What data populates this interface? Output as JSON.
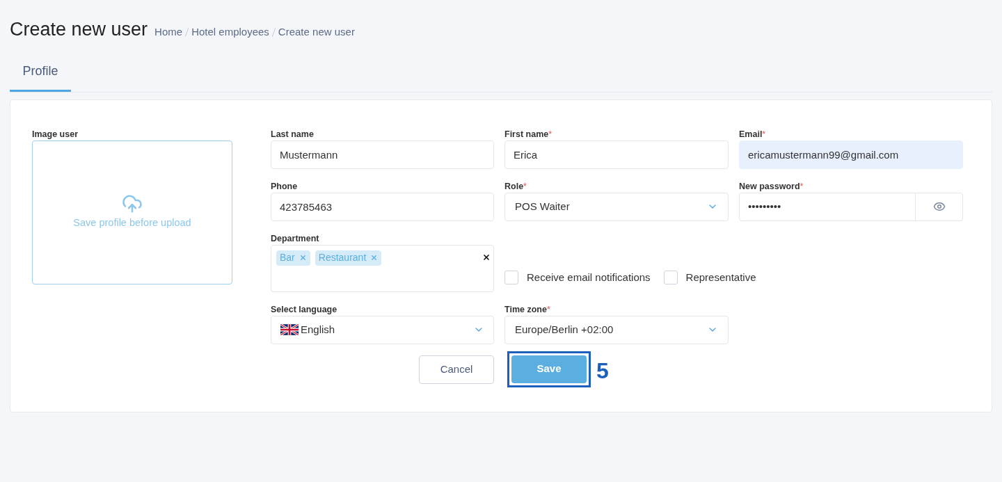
{
  "header": {
    "title": "Create new user",
    "breadcrumbs": [
      {
        "label": "Home"
      },
      {
        "label": "Hotel employees"
      },
      {
        "label": "Create new user"
      }
    ]
  },
  "tabs": [
    {
      "label": "Profile",
      "selected": true
    }
  ],
  "image": {
    "label": "Image user",
    "hint": "Save profile before upload"
  },
  "rows": [
    {
      "fields": [
        {
          "kind": "text",
          "label": "Last name",
          "value": "Mustermann",
          "autofilled": false
        },
        {
          "kind": "text",
          "label": "First name",
          "asterisk": "*",
          "value": "Erica",
          "autofilled": false
        },
        {
          "kind": "text",
          "label": "Email",
          "asterisk": "*",
          "value": "ericamustermann99@gmail.com",
          "autofilled": true
        }
      ]
    },
    {
      "fields": [
        {
          "kind": "text",
          "label": "Phone",
          "value": "423785463",
          "autofilled": false
        },
        {
          "kind": "select",
          "label": "Role",
          "asterisk": "*",
          "value": "POS Waiter"
        },
        {
          "kind": "password",
          "label": "New password",
          "asterisk": "*",
          "value": "•••••••••"
        }
      ]
    },
    {
      "fields": [
        {
          "kind": "tags",
          "label": "Department",
          "tags": [
            {
              "label": "Bar"
            },
            {
              "label": "Restaurant"
            }
          ]
        }
      ],
      "checkboxes": [
        {
          "label": "Receive email notifications",
          "checked": false
        },
        {
          "label": "Representative",
          "checked": false
        }
      ]
    },
    {
      "fields": [
        {
          "kind": "language",
          "label": "Select language",
          "value": "English"
        },
        {
          "kind": "select",
          "label": "Time zone",
          "asterisk": "*",
          "value": "Europe/Berlin +02:00"
        }
      ]
    }
  ],
  "buttons": {
    "cancel": "Cancel",
    "save": "Save"
  },
  "annotation": {
    "label": "5"
  }
}
